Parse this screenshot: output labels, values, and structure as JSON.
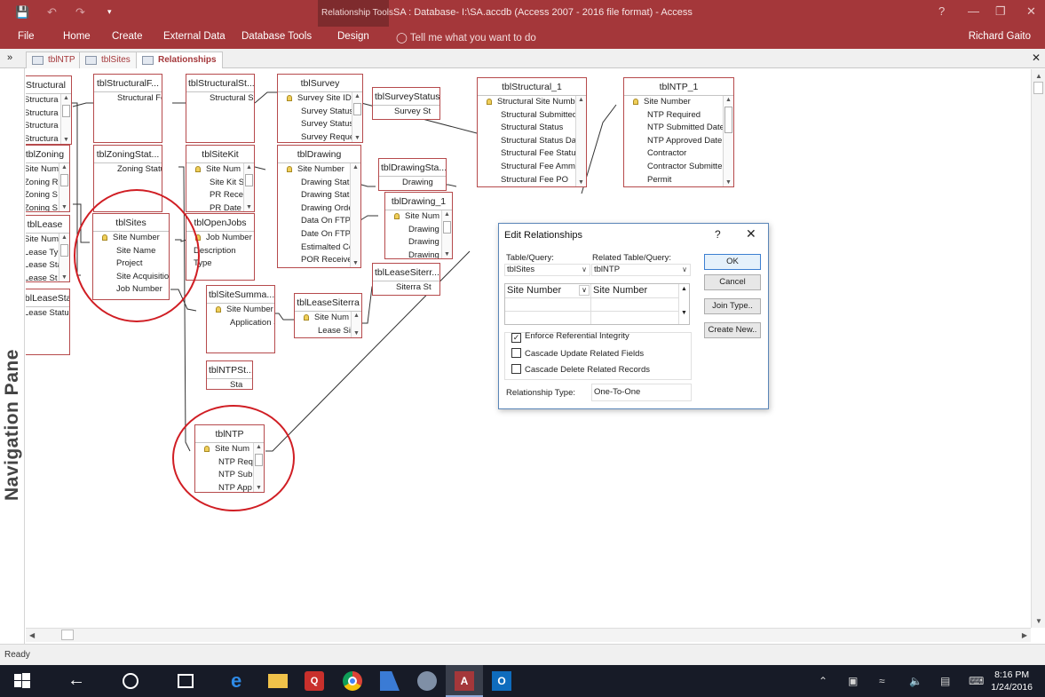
{
  "app": {
    "window_title": "SA : Database- I:\\SA.accdb (Access 2007 - 2016 file format) - Access",
    "context_tool": "Relationship Tools",
    "user": "Richard Gaito",
    "tell_me": "Tell me what you want to do",
    "window_controls": [
      "?",
      "—",
      "❐",
      "✕"
    ]
  },
  "ribbon": {
    "tabs": [
      "File",
      "Home",
      "Create",
      "External Data",
      "Database Tools",
      "Design"
    ]
  },
  "doc_tabs": [
    "tblNTP",
    "tblSites",
    "Relationships"
  ],
  "nav_pane": {
    "label": "Navigation Pane"
  },
  "tables": {
    "structural": {
      "title": "Structural",
      "fields": [
        "Structura",
        "Structura",
        "Structura",
        "Structura"
      ]
    },
    "tblstructuralf": {
      "title": "tblStructuralF...",
      "fields": [
        "Structural Fe"
      ]
    },
    "tblstructuralst": {
      "title": "tblStructuralSt...",
      "fields": [
        "Structural St"
      ]
    },
    "tblsurvey": {
      "title": "tblSurvey",
      "fields": [
        "Survey Site ID",
        "Survey Status",
        "Survey Status",
        "Survey Reque"
      ]
    },
    "tblsurveystatus": {
      "title": "tblSurveyStatus",
      "fields": [
        "Survey St"
      ]
    },
    "tblstructural_1": {
      "title": "tblStructural_1",
      "fields": [
        "Structural Site Numb",
        "Structural Submitted",
        "Structural Status",
        "Structural Status Dat",
        "Structural Fee Status",
        "Structural Fee Ammo",
        "Structural Fee PO"
      ]
    },
    "tblntp_1": {
      "title": "tblNTP_1",
      "fields": [
        "Site Number",
        "NTP Required",
        "NTP Submitted Date",
        "NTP Approved Date",
        "Contractor",
        "Contractor Submitte",
        "Permit"
      ]
    },
    "tblzoning": {
      "title": "tblZoning",
      "fields": [
        "Site Num",
        "Zoning R",
        "Zoning S",
        "Zoning S"
      ]
    },
    "tblzoningstat": {
      "title": "tblZoningStat...",
      "fields": [
        "Zoning Statu"
      ]
    },
    "tblsitekit": {
      "title": "tblSiteKit",
      "fields": [
        "Site Num",
        "Site Kit S",
        "PR Recei",
        "PR Date"
      ]
    },
    "tbldrawing": {
      "title": "tblDrawing",
      "fields": [
        "Site Number",
        "Drawing Statu",
        "Drawing Statu",
        "Drawing Orde",
        "Data On FTP",
        "Date On FTP",
        "Estimalted Cc",
        "POR Receivec"
      ]
    },
    "tbldrawingsta": {
      "title": "tblDrawingSta...",
      "fields": [
        "Drawing"
      ]
    },
    "tbldrawing_1": {
      "title": "tblDrawing_1",
      "fields": [
        "Site Num",
        "Drawing",
        "Drawing",
        "Drawing"
      ]
    },
    "tbllease": {
      "title": "tblLease",
      "fields": [
        "Site Num",
        "Lease Typ",
        "Lease Sta",
        "Lease St"
      ]
    },
    "tblsites": {
      "title": "tblSites",
      "fields": [
        "Site Number",
        "Site Name",
        "Project",
        "Site Acquisition",
        "Job Number"
      ]
    },
    "tblopenjobs": {
      "title": "tblOpenJobs",
      "fields": [
        "Job Number",
        "Description",
        "Type"
      ]
    },
    "tblleasesiterr": {
      "title": "tblLeaseSiterr...",
      "fields": [
        "Siterra St"
      ]
    },
    "tblleasestatus": {
      "title": "tblLeaseStatus",
      "fields": [
        "Lease Status"
      ]
    },
    "tblsitesumma": {
      "title": "tblSiteSumma...",
      "fields": [
        "Site Number",
        "Application S"
      ]
    },
    "tblleasesiterra": {
      "title": "tblLeaseSiterra",
      "fields": [
        "Site Num",
        "Lease Sit"
      ]
    },
    "tblntpst": {
      "title": "tblNTPSt...",
      "fields": [
        "Sta"
      ]
    },
    "tblntp": {
      "title": "tblNTP",
      "fields": [
        "Site Num",
        "NTP Req",
        "NTP Sub",
        "NTP App"
      ]
    }
  },
  "dialog": {
    "title": "Edit Relationships",
    "help": "?",
    "close": "✕",
    "table_label": "Table/Query:",
    "related_label": "Related Table/Query:",
    "table_value": "tblSites",
    "related_value": "tblNTP",
    "left_field": "Site Number",
    "right_field": "Site Number",
    "enforce": {
      "label": "Enforce Referential Integrity",
      "checked": true
    },
    "cascade_update": {
      "label": "Cascade Update Related Fields",
      "checked": false
    },
    "cascade_delete": {
      "label": "Cascade Delete Related Records",
      "checked": false
    },
    "relationship_type_label": "Relationship Type:",
    "relationship_type": "One-To-One",
    "buttons": {
      "ok": "OK",
      "cancel": "Cancel",
      "join_type": "Join Type..",
      "create_new": "Create New.."
    }
  },
  "status_bar": "Ready",
  "clock": {
    "time": "8:16 PM",
    "date": "1/24/2016"
  },
  "colors": {
    "accent": "#a4373a",
    "table_border": "#b64a4c",
    "highlight_circle": "#d01e24",
    "taskbar": "#171b27"
  }
}
